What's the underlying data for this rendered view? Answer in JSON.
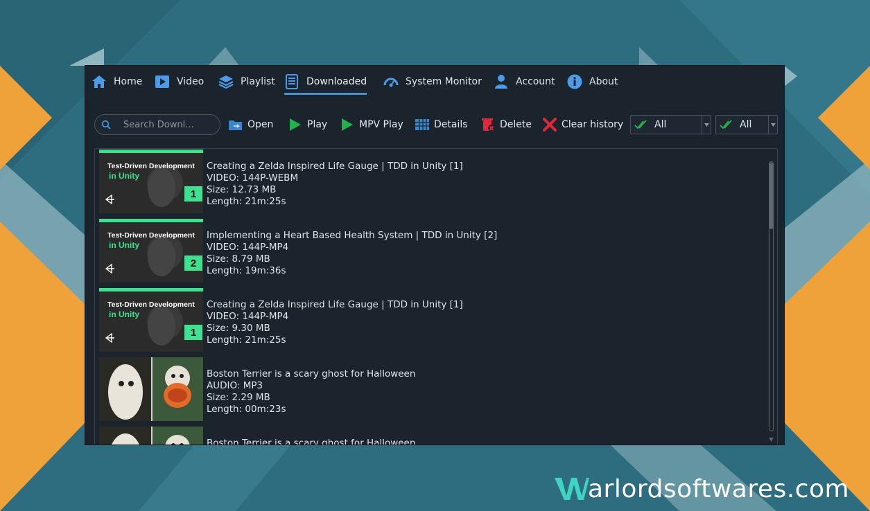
{
  "nav": {
    "items": [
      {
        "label": "Home",
        "icon": "home-icon"
      },
      {
        "label": "Video",
        "icon": "video-play-icon"
      },
      {
        "label": "Playlist",
        "icon": "layers-icon"
      },
      {
        "label": "Downloaded",
        "icon": "downloaded-list-icon",
        "active": true
      },
      {
        "label": "System Monitor",
        "icon": "speedometer-icon"
      },
      {
        "label": "Account",
        "icon": "user-icon"
      },
      {
        "label": "About",
        "icon": "info-icon"
      }
    ]
  },
  "toolbar": {
    "search_placeholder": "Search Downl...",
    "open_label": "Open",
    "play_label": "Play",
    "mpv_play_label": "MPV Play",
    "details_label": "Details",
    "delete_label": "Delete",
    "clear_history_label": "Clear history",
    "filter1_value": "All",
    "filter2_value": "All"
  },
  "downloads": [
    {
      "title": "Creating a Zelda Inspired Life Gauge | TDD in Unity [1]",
      "format": "VIDEO: 144P-WEBM",
      "size": "Size: 12.73 MB",
      "length": "Length: 21m:25s",
      "thumb": "tdd",
      "thumb_number": "1",
      "thumb_line1": "Test-Driven Development",
      "thumb_line2": "in Unity"
    },
    {
      "title": "Implementing a Heart Based Health System | TDD in Unity [2]",
      "format": "VIDEO: 144P-MP4",
      "size": "Size: 8.79 MB",
      "length": "Length: 19m:36s",
      "thumb": "tdd",
      "thumb_number": "2",
      "thumb_line1": "Test-Driven Development",
      "thumb_line2": "in Unity"
    },
    {
      "title": "Creating a Zelda Inspired Life Gauge | TDD in Unity [1]",
      "format": "VIDEO: 144P-MP4",
      "size": "Size: 9.30 MB",
      "length": "Length: 21m:25s",
      "thumb": "tdd",
      "thumb_number": "1",
      "thumb_line1": "Test-Driven Development",
      "thumb_line2": "in Unity"
    },
    {
      "title": "Boston Terrier is a scary ghost for Halloween",
      "format": "AUDIO: MP3",
      "size": "Size: 2.29 MB",
      "length": "Length: 00m:23s",
      "thumb": "dog"
    },
    {
      "title": "Boston Terrier is a scary ghost for Halloween",
      "format": "",
      "size": "",
      "length": "",
      "thumb": "dog"
    }
  ],
  "watermark": {
    "text": "arlordsoftwares.com"
  },
  "colors": {
    "accent": "#3d97d6",
    "play_green": "#22b14c",
    "delete_red": "#e0283a",
    "thumb_green": "#3fe08f",
    "orange": "#f0a23a",
    "teal": "#2f6e80"
  }
}
